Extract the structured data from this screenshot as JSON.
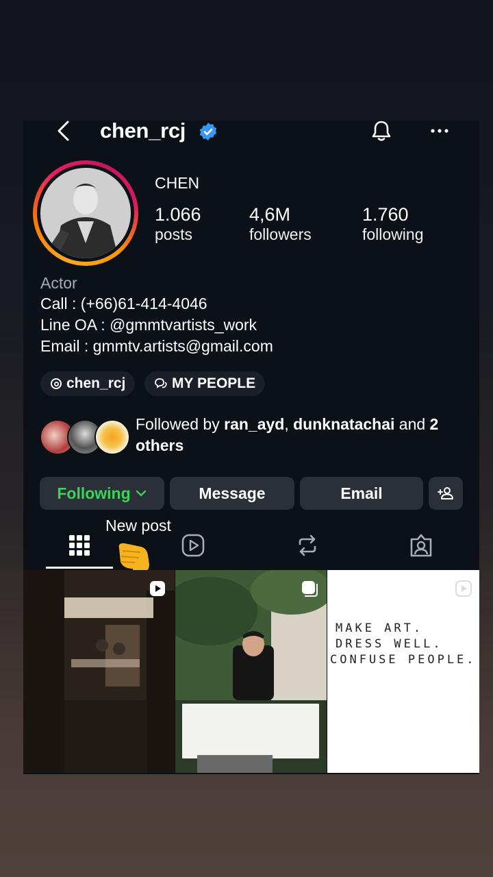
{
  "header": {
    "username": "chen_rcj",
    "back_icon": "chevron-left-icon",
    "verified_icon": "verified-badge-icon",
    "bell_icon": "bell-icon",
    "more_icon": "more-horizontal-icon"
  },
  "profile": {
    "display_name": "CHEN",
    "stats": [
      {
        "value": "1.066",
        "label": "posts"
      },
      {
        "value": "4,6M",
        "label": "followers"
      },
      {
        "value": "1.760",
        "label": "following"
      }
    ],
    "category": "Actor",
    "bio_lines": [
      "Call : (+66)61-414-4046",
      "Line OA : @gmmtvartists_work",
      "Email : gmmtv.artists@gmail.com"
    ]
  },
  "chips": [
    {
      "label": "chen_rcj",
      "icon": "threads-icon"
    },
    {
      "label": "MY PEOPLE",
      "icon": "chat-bubbles-icon"
    }
  ],
  "followed_by": {
    "prefix": "Followed by ",
    "user1": "ran_ayd",
    "sep": ", ",
    "user2": "dunknatachai",
    "mid": " and ",
    "count": "2",
    "suffix": "others"
  },
  "actions": {
    "following": "Following",
    "message": "Message",
    "email": "Email",
    "add_user_icon": "add-person-icon"
  },
  "tooltip": "New post",
  "tabs": [
    "grid-icon",
    "reels-icon",
    "reposts-icon",
    "tagged-icon"
  ],
  "posts": [
    {
      "type": "reel",
      "badge_icon": "reel-badge-icon"
    },
    {
      "type": "carousel",
      "badge_icon": "carousel-badge-icon"
    },
    {
      "type": "reel",
      "badge_icon": "reel-badge-icon",
      "text_lines": [
        "MAKE ART.",
        "DRESS WELL.",
        "CONFUSE PEOPLE."
      ]
    }
  ],
  "colors": {
    "accent_green": "#3fd25a",
    "verified_blue": "#3897f0",
    "card_bg": "#0c1017",
    "button_bg": "#2a2f38"
  }
}
